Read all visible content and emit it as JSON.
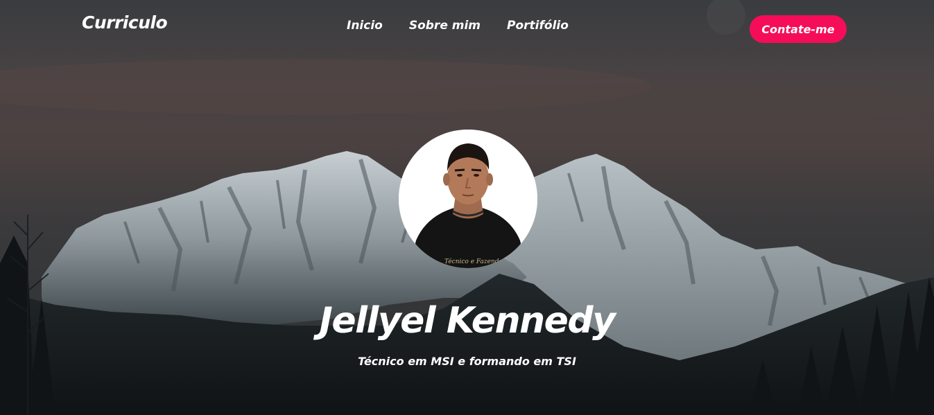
{
  "navbar": {
    "brand": "Curriculo",
    "links": [
      "Inicio",
      "Sobre mim",
      "Portifólio"
    ],
    "contact_label": "Contate-me"
  },
  "hero": {
    "name": "Jellyel Kennedy",
    "subtitle": "Técnico em MSI e formando em TSI",
    "shirt_text": "Técnico e Fazendo"
  },
  "colors": {
    "accent": "#f50d5a",
    "sky_top": "#3d3f42",
    "sky_glow": "#5a4846",
    "mountain": "#c9d2d6",
    "forest": "#15191b"
  }
}
